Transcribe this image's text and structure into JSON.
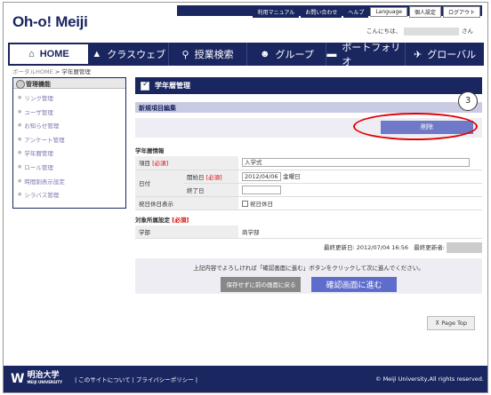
{
  "header": {
    "logo": "Oh-o! Meiji",
    "util_links": [
      "利用マニュアル",
      "お問い合わせ",
      "ヘルプ"
    ],
    "util_buttons": [
      "Language",
      "個人設定",
      "ログアウト"
    ],
    "greeting_prefix": "こんにちは、",
    "greeting_suffix": "さん"
  },
  "nav": {
    "items": [
      {
        "label": "HOME",
        "icon": "home-icon"
      },
      {
        "label": "クラスウェブ",
        "icon": "graduation-cap-icon"
      },
      {
        "label": "授業検索",
        "icon": "search-icon"
      },
      {
        "label": "グループ",
        "icon": "group-icon"
      },
      {
        "label": "ポートフォリオ",
        "icon": "folder-icon"
      },
      {
        "label": "グローバル",
        "icon": "airplane-icon"
      }
    ]
  },
  "breadcrumb": {
    "link": "ポータルHOME",
    "sep": " > ",
    "current": "学年暦管理"
  },
  "sidebar": {
    "title": "管理機能",
    "items": [
      "リンク管理",
      "ユーザ管理",
      "お知らせ管理",
      "アンケート管理",
      "学年暦管理",
      "ロール管理",
      "時間割表示設定",
      "シラバス管理"
    ]
  },
  "main": {
    "title": "学年暦管理",
    "subtitle": "新規項目編集",
    "delete_label": "削除",
    "callout_number": "3",
    "section1": "学年暦情報",
    "item_label": "項目",
    "required": "[必須]",
    "item_value": "入学式",
    "date_label": "日付",
    "start_label": "開始日",
    "start_value": "2012/04/06",
    "start_day": "金曜日",
    "end_label": "終了日",
    "holiday_label": "祝日休日表示",
    "holiday_check_label": "祝日休日",
    "section2": "対象所属設定",
    "dept_label": "学部",
    "dept_value": "商学部",
    "updated_label": "最終更新日:",
    "updated_value": "2012/07/04 16:56",
    "updater_label": "最終更新者:",
    "confirm_text": "上記内容でよろしければ「確認画面に進む」ボタンをクリックして次に進んでください。",
    "back_button": "保存せずに前の画面に戻る",
    "go_button": "確認画面に進む",
    "page_top": "Page Top"
  },
  "footer": {
    "univ_name": "明治大学",
    "univ_sub": "MEIJI UNIVERSITY",
    "links": "|  このサイトについて  |  プライバシーポリシー  |",
    "copyright": "© Meiji University,All rights reserved."
  }
}
